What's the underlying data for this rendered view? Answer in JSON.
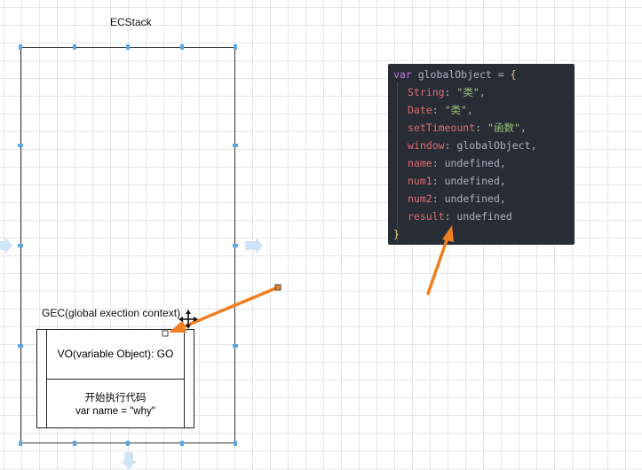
{
  "ecstack": {
    "title": "ECStack"
  },
  "gec": {
    "title": "GEC(global exection context)",
    "vo": "VO(variable Object): GO",
    "exec_line1": "开始执行代码",
    "exec_line2": "var name = \"why\""
  },
  "code": {
    "keyword": "var",
    "identifier": " globalObject = ",
    "open_brace": "{",
    "close_brace": "}",
    "lines": [
      {
        "prop": "String",
        "value": "\"类\"",
        "value_type": "string"
      },
      {
        "prop": "Date",
        "value": "\"类\"",
        "value_type": "string"
      },
      {
        "prop": "setTimeount",
        "value": "\"函数\"",
        "value_type": "string"
      },
      {
        "prop": "window",
        "value": "globalObject",
        "value_type": "ident"
      },
      {
        "prop": "name",
        "value": "undefined",
        "value_type": "ident"
      },
      {
        "prop": "num1",
        "value": "undefined",
        "value_type": "ident"
      },
      {
        "prop": "num2",
        "value": "undefined",
        "value_type": "ident"
      },
      {
        "prop": "result",
        "value": "undefined",
        "value_type": "ident",
        "last": true
      }
    ]
  },
  "colors": {
    "arrow": "#f07f22",
    "code_bg": "#282c34",
    "keyword": "#c678dd",
    "property": "#e06c75",
    "string": "#98c379",
    "plain": "#abb2bf"
  }
}
